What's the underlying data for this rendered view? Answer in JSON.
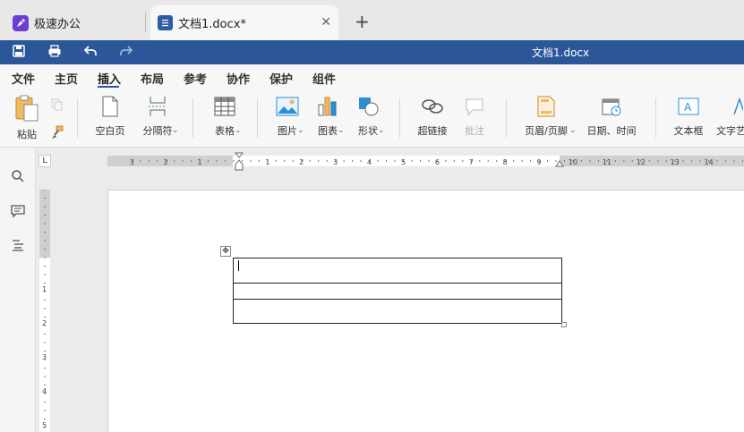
{
  "tabs": {
    "home": {
      "title": "极速办公",
      "icon": "rocket-icon"
    },
    "doc": {
      "title": "文档1.docx*",
      "icon": "document-icon"
    },
    "close_icon": "close-icon",
    "add_icon": "plus-icon"
  },
  "titlebar": {
    "title": "文档1.docx",
    "color": "#2b579a"
  },
  "menu": {
    "items": [
      "文件",
      "主页",
      "插入",
      "布局",
      "参考",
      "协作",
      "保护",
      "组件"
    ],
    "active": "插入"
  },
  "ribbon": {
    "paste": "粘贴",
    "blank_page": "空白页",
    "separator": "分隔符",
    "table": "表格",
    "picture": "图片",
    "chart": "图表",
    "shape": "形状",
    "hyperlink": "超链接",
    "comment": "批注",
    "header_footer": "页眉/页脚",
    "date_time": "日期、时间",
    "textbox": "文本框",
    "textart": "文字艺"
  },
  "hruler": {
    "labels_left": [
      "3",
      "2",
      "1"
    ],
    "labels_right": [
      "1",
      "2",
      "3",
      "4",
      "5",
      "6",
      "7",
      "8",
      "9",
      "10",
      "11",
      "12",
      "13",
      "14"
    ]
  },
  "vruler": {
    "labels": [
      "1",
      "2",
      "3",
      "4",
      "5"
    ]
  },
  "document": {
    "table_rows": 3,
    "table_cols": 1
  },
  "corner_label": "L"
}
